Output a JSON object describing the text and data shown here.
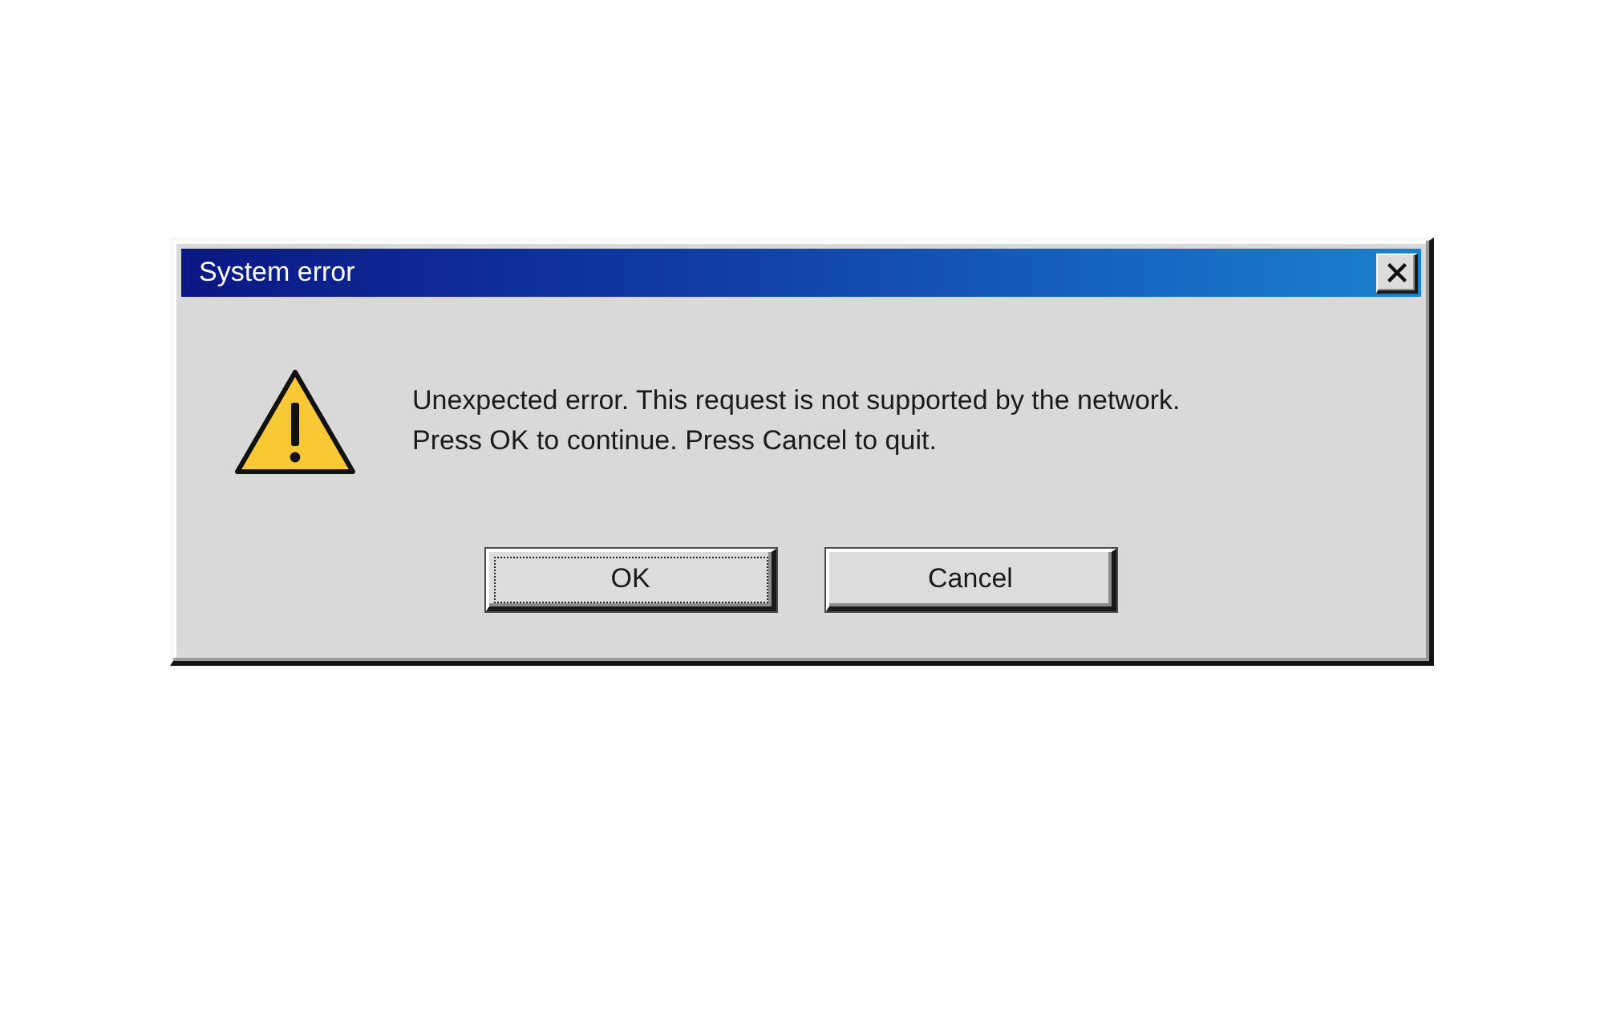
{
  "window": {
    "title": "System error"
  },
  "message": [
    "Unexpected error. This request is not supported by the network.",
    "Press OK to continue. Press Cancel to quit."
  ],
  "buttons": [
    {
      "label": "OK",
      "focused": true
    },
    {
      "label": "Cancel",
      "focused": false
    }
  ]
}
